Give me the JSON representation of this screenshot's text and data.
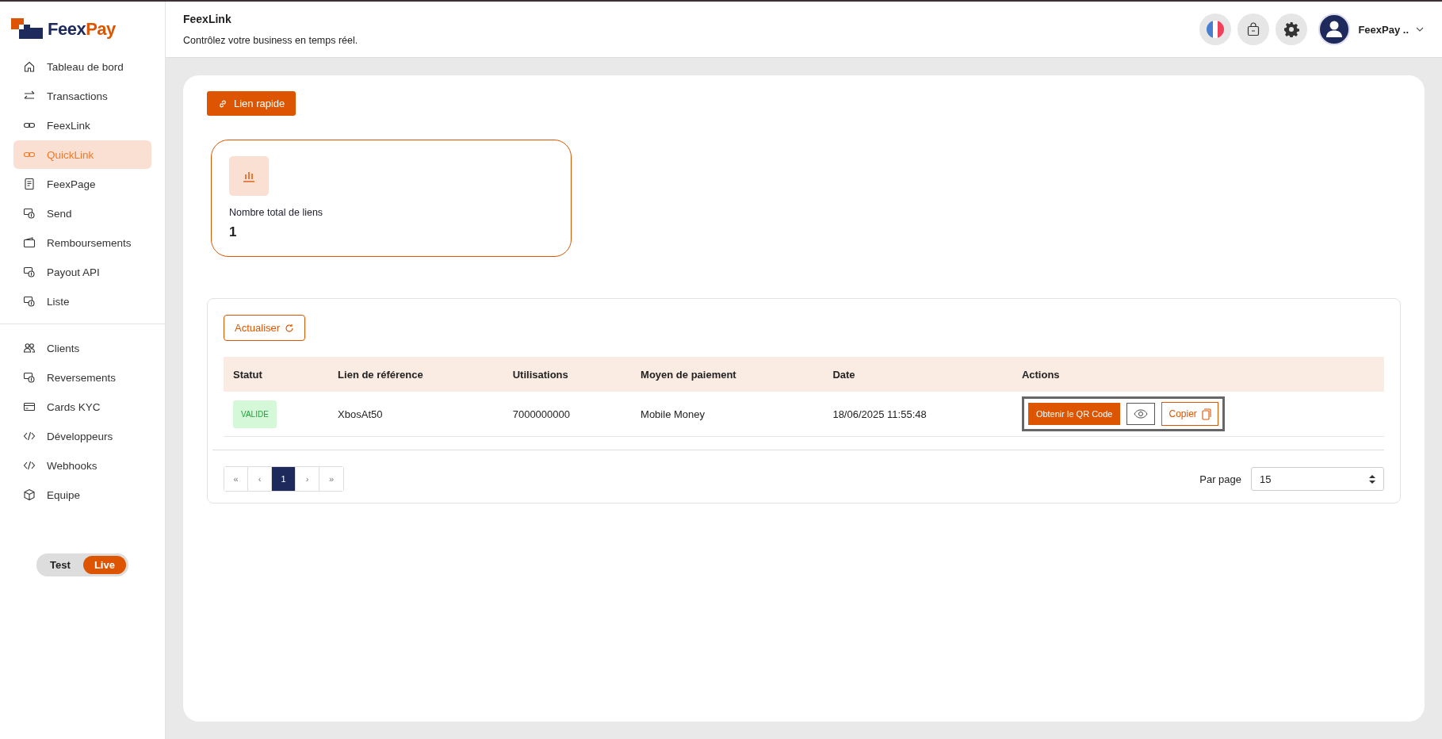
{
  "brand": {
    "name_part_1": "Feex",
    "name_part_2": "Pay"
  },
  "sidebar": {
    "groups": [
      [
        {
          "label": "Tableau de bord",
          "kind": "home",
          "selected": false
        },
        {
          "label": "Transactions",
          "kind": "arrows",
          "selected": false
        },
        {
          "label": "FeexLink",
          "kind": "link",
          "selected": false
        },
        {
          "label": "QuickLink",
          "kind": "link",
          "selected": true
        },
        {
          "label": "FeexPage",
          "kind": "document",
          "selected": false
        },
        {
          "label": "Send",
          "kind": "money",
          "selected": false
        },
        {
          "label": "Remboursements",
          "kind": "wallet",
          "selected": false
        },
        {
          "label": "Payout API",
          "kind": "money",
          "selected": false
        },
        {
          "label": "Liste",
          "kind": "money",
          "selected": false
        }
      ],
      [
        {
          "label": "Clients",
          "kind": "people",
          "selected": false
        },
        {
          "label": "Reversements",
          "kind": "money",
          "selected": false
        },
        {
          "label": "Cards KYC",
          "kind": "card",
          "selected": false
        },
        {
          "label": "Développeurs",
          "kind": "code",
          "selected": false
        },
        {
          "label": "Webhooks",
          "kind": "code",
          "selected": false
        },
        {
          "label": "Equipe",
          "kind": "box",
          "selected": false
        }
      ]
    ],
    "mode_toggle": [
      {
        "label": "Test",
        "selected": false
      },
      {
        "label": "Live",
        "selected": true
      }
    ]
  },
  "header": {
    "title": "FeexLink",
    "subtitle": "Contrôlez votre business en temps réel.",
    "user_name": "FeexPay .."
  },
  "quick_link_button": "Lien rapide",
  "stat_card": {
    "label": "Nombre total de liens",
    "value": "1"
  },
  "table": {
    "refresh_button": "Actualiser",
    "columns": [
      "Statut",
      "Lien de référence",
      "Utilisations",
      "Moyen de paiement",
      "Date",
      "Actions"
    ],
    "rows": [
      {
        "status": "VALIDE",
        "reference": "XbosAt50",
        "uses": "7000000000",
        "payment_method": "Mobile Money",
        "date": "18/06/2025 11:55:48",
        "qr_button": "Obtenir le QR Code",
        "copy_button": "Copier"
      }
    ]
  },
  "pagination": {
    "pages": [
      {
        "label": "«",
        "selected": false
      },
      {
        "label": "‹",
        "selected": false
      },
      {
        "label": "1",
        "selected": true
      },
      {
        "label": "›",
        "selected": false
      },
      {
        "label": "»",
        "selected": false
      }
    ],
    "per_page_label": "Par page",
    "per_page_value": "15"
  }
}
